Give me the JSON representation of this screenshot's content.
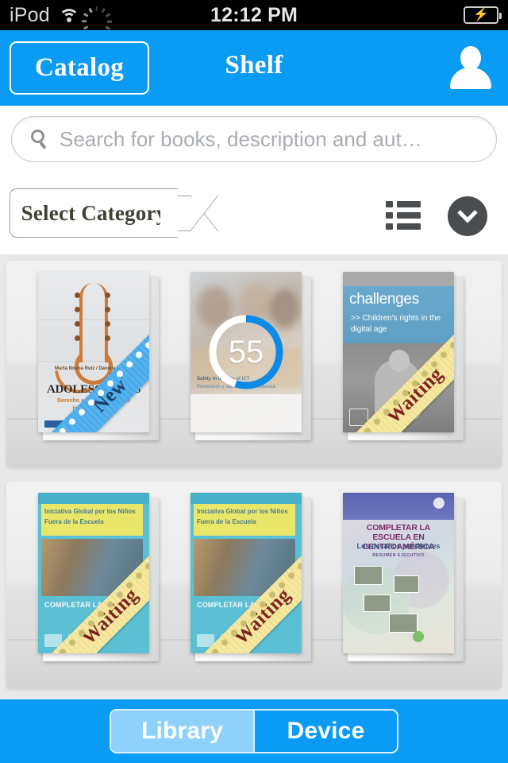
{
  "status_bar": {
    "carrier": "iPod",
    "time": "12:12 PM",
    "wifi_icon": "wifi-icon",
    "activity_icon": "activity-spinner-icon",
    "battery_icon": "battery-charging-icon"
  },
  "navbar": {
    "back_label": "Catalog",
    "title": "Shelf",
    "profile_icon": "person-icon",
    "bg_color": "#0a9bf5"
  },
  "search": {
    "placeholder": "Search for books, description and aut…",
    "value": "",
    "icon": "search-icon"
  },
  "filters": {
    "category_label": "Select Category",
    "list_view_icon": "list-view-icon",
    "expand_icon": "chevron-down-icon"
  },
  "shelves": [
    {
      "books": [
        {
          "title": "ADOLESCENTES",
          "subtitle": "Derecho a la educación y al bienestar futuro",
          "authors": "Marta Novoa Ruiz / Daniela Trucco",
          "cover_style": "cv-adolescentes",
          "badge": "New",
          "badge_type": "new",
          "progress": null
        },
        {
          "title": "Safety in the use of ICT",
          "subtitle": "Prevención y atención de la violencia",
          "authors": "",
          "cover_style": "cv-photo",
          "badge": null,
          "badge_type": null,
          "progress": 55
        },
        {
          "title": "challenges",
          "subtitle": ">> Children's rights in the digital age",
          "authors": "",
          "cover_style": "cv-challenges",
          "badge": "Waiting",
          "badge_type": "waiting",
          "progress": null
        }
      ]
    },
    {
      "books": [
        {
          "title": "COMPLETAR LA ESCUELA",
          "subtitle": "Iniciativa Global por los Niños Fuera de la Escuela",
          "authors": "",
          "cover_style": "cv-completar",
          "badge": "Waiting",
          "badge_type": "waiting",
          "progress": null
        },
        {
          "title": "COMPLETAR LA ESCUELA",
          "subtitle": "Iniciativa Global por los Niños Fuera de la Escuela",
          "authors": "",
          "cover_style": "cv-completar",
          "badge": "Waiting",
          "badge_type": "waiting",
          "progress": null
        },
        {
          "title": "COMPLETAR LA ESCUELA EN CENTROAMÉRICA",
          "subtitle": "Los desafíos pendientes",
          "authors": "RESUMEN EJECUTIVO",
          "cover_style": "cv-centro",
          "badge": null,
          "badge_type": null,
          "progress": null
        }
      ]
    }
  ],
  "tabbar": {
    "segments": [
      {
        "label": "Library",
        "selected": true
      },
      {
        "label": "Device",
        "selected": false
      }
    ],
    "bg_color": "#0a9bf5",
    "selected_color": "#8ed2fb"
  },
  "colors": {
    "accent": "#0a9bf5",
    "progress_ring": "#0b8ae8",
    "ribbon_new": "#4aa9e8",
    "ribbon_waiting": "#f0e193",
    "shelf": "#e8e8e8"
  }
}
